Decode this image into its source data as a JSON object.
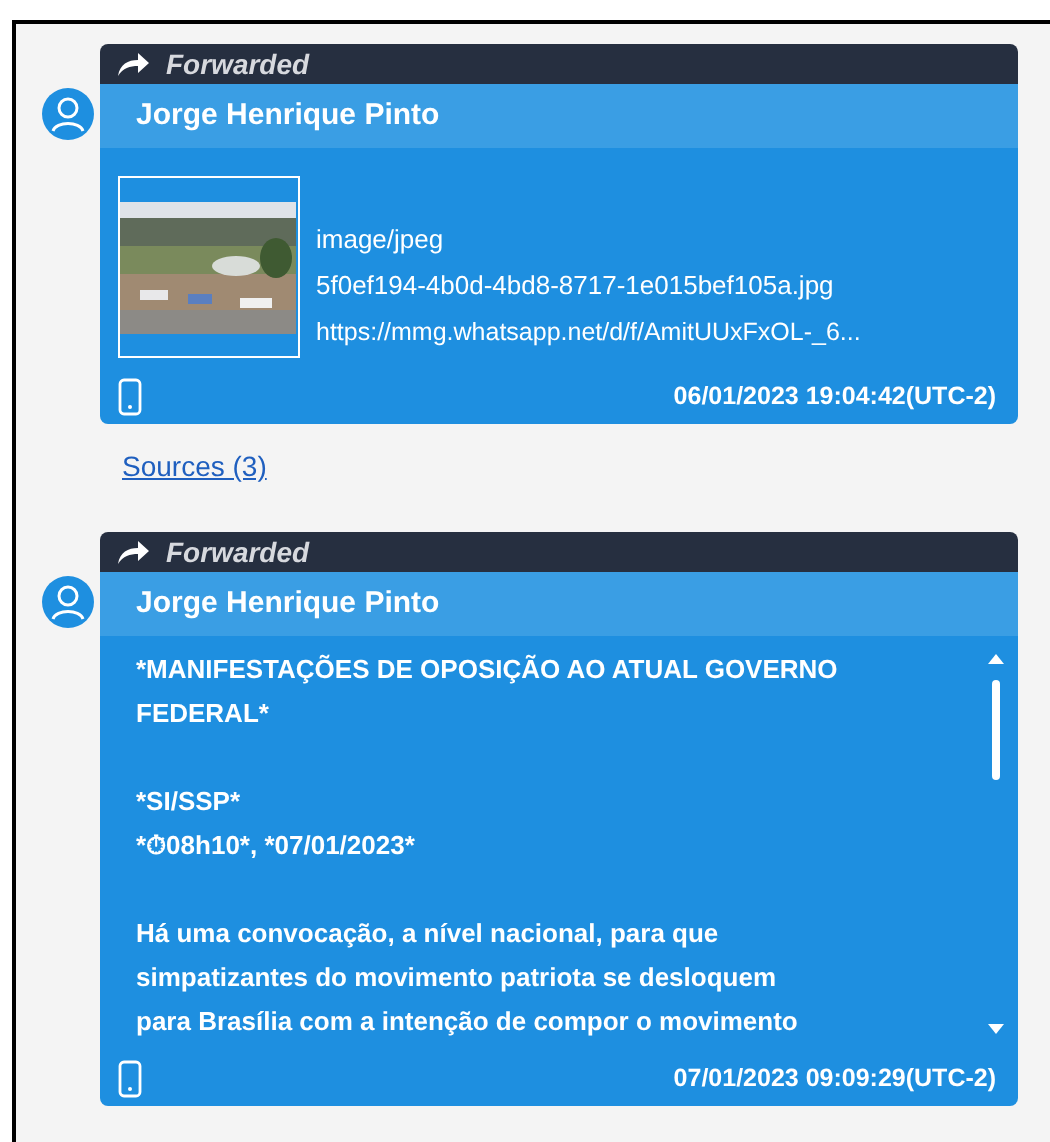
{
  "messages": [
    {
      "forwarded_label": "Forwarded",
      "sender": "Jorge Henrique Pinto",
      "kind": "attachment",
      "attachment": {
        "mime": "image/jpeg",
        "filename": "5f0ef194-4b0d-4bd8-8717-1e015bef105a.jpg",
        "url": "https://mmg.whatsapp.net/d/f/AmitUUxFxOL-_6..."
      },
      "timestamp": "06/01/2023 19:04:42(UTC-2)",
      "sources": "Sources (3)"
    },
    {
      "forwarded_label": "Forwarded",
      "sender": "Jorge Henrique Pinto",
      "kind": "text",
      "paragraphs": [
        [
          "*MANIFESTAÇÕES DE OPOSIÇÃO AO ATUAL GOVERNO",
          "FEDERAL*"
        ],
        [
          "*SI/SSP*",
          "*⏱08h10*, *07/01/2023*"
        ],
        [
          "Há uma convocação, a nível nacional, para que",
          "simpatizantes do movimento patriota se desloquem",
          "para Brasília com a intenção de compor o movimento"
        ]
      ],
      "timestamp": "07/01/2023 09:09:29(UTC-2)"
    }
  ]
}
